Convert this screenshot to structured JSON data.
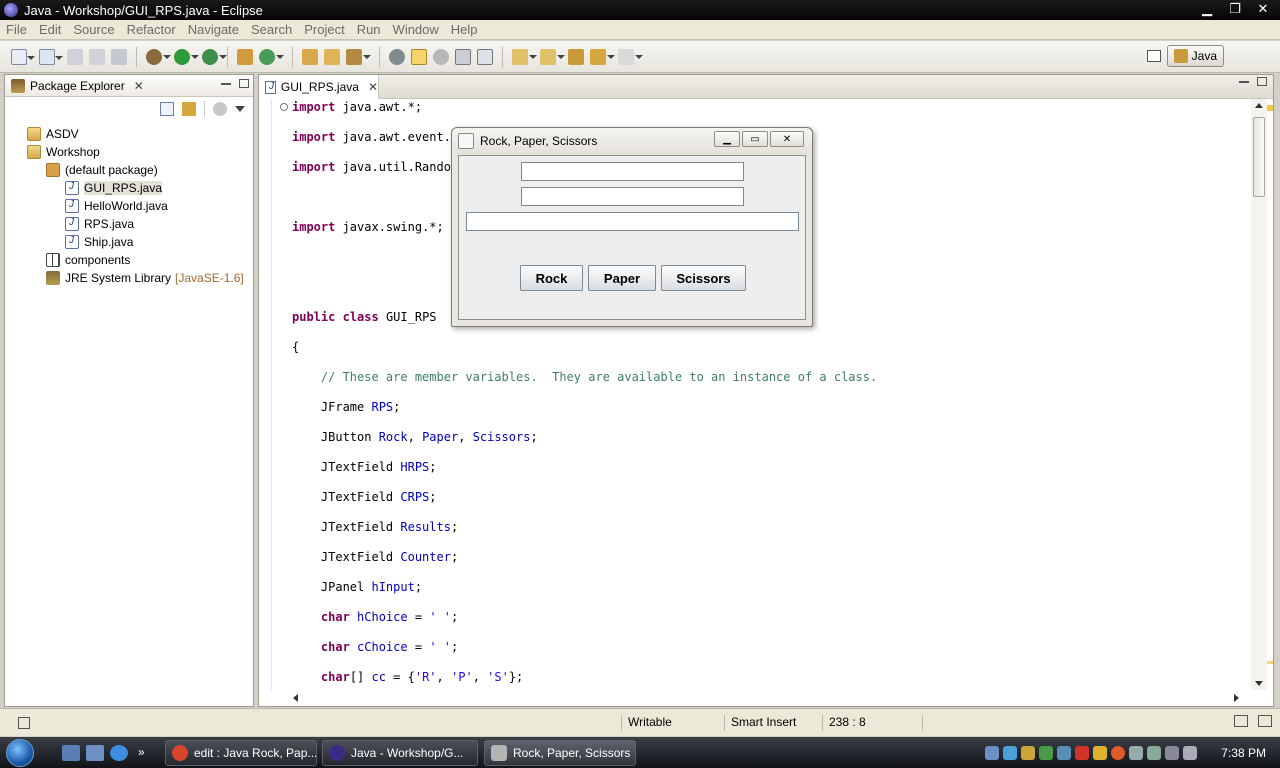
{
  "window": {
    "title": "Java - Workshop/GUI_RPS.java - Eclipse"
  },
  "menu": [
    "File",
    "Edit",
    "Source",
    "Refactor",
    "Navigate",
    "Search",
    "Project",
    "Run",
    "Window",
    "Help"
  ],
  "perspective": {
    "label": "Java"
  },
  "package_explorer": {
    "title": "Package Explorer",
    "tree": [
      {
        "label": "ASDV",
        "icon": "project-folder-icon",
        "level": 1
      },
      {
        "label": "Workshop",
        "icon": "project-folder-icon",
        "level": 1
      },
      {
        "label": "(default package)",
        "icon": "package-icon",
        "level": 2
      },
      {
        "label": "GUI_RPS.java",
        "icon": "java-file-icon",
        "level": 3,
        "selected": true
      },
      {
        "label": "HelloWorld.java",
        "icon": "java-file-icon",
        "level": 3
      },
      {
        "label": "RPS.java",
        "icon": "java-file-icon",
        "level": 3
      },
      {
        "label": "Ship.java",
        "icon": "java-file-icon",
        "level": 3
      },
      {
        "label": "components",
        "icon": "folder-grid-icon",
        "level": 2
      },
      {
        "label": "JRE System Library",
        "tag": "[JavaSE-1.6]",
        "icon": "library-icon",
        "level": 2
      }
    ]
  },
  "editor": {
    "tab": "GUI_RPS.java",
    "lines": [
      [
        [
          "kw",
          "import"
        ],
        [
          "t",
          " java.awt.*;"
        ]
      ],
      [
        [
          "kw",
          "import"
        ],
        [
          "t",
          " java.awt.event.*"
        ]
      ],
      [
        [
          "kw",
          "import"
        ],
        [
          "t",
          " java.util.Random"
        ]
      ],
      [],
      [
        [
          "kw",
          "import"
        ],
        [
          "t",
          " javax.swing.*;"
        ]
      ],
      [],
      [],
      [
        [
          "kw",
          "public"
        ],
        [
          "t",
          " "
        ],
        [
          "kw",
          "class"
        ],
        [
          "t",
          " GUI_RPS"
        ]
      ],
      [
        [
          "t",
          "{"
        ]
      ],
      [
        [
          "t",
          "    "
        ],
        [
          "cm",
          "// These are member variables.  They are available to an instance of a class."
        ]
      ],
      [
        [
          "t",
          "    JFrame "
        ],
        [
          "fd",
          "RPS"
        ],
        [
          "t",
          ";"
        ]
      ],
      [
        [
          "t",
          "    JButton "
        ],
        [
          "fd",
          "Rock"
        ],
        [
          "t",
          ", "
        ],
        [
          "fd",
          "Paper"
        ],
        [
          "t",
          ", "
        ],
        [
          "fd",
          "Scissors"
        ],
        [
          "t",
          ";"
        ]
      ],
      [
        [
          "t",
          "    JTextField "
        ],
        [
          "fd",
          "HRPS"
        ],
        [
          "t",
          ";"
        ]
      ],
      [
        [
          "t",
          "    JTextField "
        ],
        [
          "fd",
          "CRPS"
        ],
        [
          "t",
          ";"
        ]
      ],
      [
        [
          "t",
          "    JTextField "
        ],
        [
          "fd",
          "Results"
        ],
        [
          "t",
          ";"
        ]
      ],
      [
        [
          "t",
          "    JTextField "
        ],
        [
          "fd",
          "Counter"
        ],
        [
          "t",
          ";"
        ]
      ],
      [
        [
          "t",
          "    JPanel "
        ],
        [
          "fd",
          "hInput"
        ],
        [
          "t",
          ";"
        ]
      ],
      [
        [
          "t",
          "    "
        ],
        [
          "kw",
          "char"
        ],
        [
          "t",
          " "
        ],
        [
          "fd",
          "hChoice"
        ],
        [
          "t",
          " = "
        ],
        [
          "st",
          "' '"
        ],
        [
          "t",
          ";"
        ]
      ],
      [
        [
          "t",
          "    "
        ],
        [
          "kw",
          "char"
        ],
        [
          "t",
          " "
        ],
        [
          "fd",
          "cChoice"
        ],
        [
          "t",
          " = "
        ],
        [
          "st",
          "' '"
        ],
        [
          "t",
          ";"
        ]
      ],
      [
        [
          "t",
          "    "
        ],
        [
          "kw",
          "char"
        ],
        [
          "t",
          "[] "
        ],
        [
          "fd",
          "cc"
        ],
        [
          "t",
          " = {"
        ],
        [
          "st",
          "'R'"
        ],
        [
          "t",
          ", "
        ],
        [
          "st",
          "'P'"
        ],
        [
          "t",
          ", "
        ],
        [
          "st",
          "'S'"
        ],
        [
          "t",
          "};"
        ]
      ]
    ]
  },
  "app_frame": {
    "title": "Rock, Paper, Scissors",
    "buttons": {
      "rock": "Rock",
      "paper": "Paper",
      "scissors": "Scissors"
    }
  },
  "status": {
    "writable": "Writable",
    "insert_mode": "Smart Insert",
    "position": "238 : 8"
  },
  "taskbar": {
    "items": [
      {
        "label": "edit : Java Rock, Pap...",
        "color": "#d9452c"
      },
      {
        "label": "Java - Workshop/G...",
        "color": "#3b2a86"
      },
      {
        "label": "Rock, Paper, Scissors",
        "color": "#b4b4b4"
      }
    ],
    "clock": "7:38 PM",
    "more_glyph": "»"
  },
  "colors": {
    "keyword": "#7f0055",
    "comment": "#3f7f5f",
    "field": "#0000c0",
    "string": "#2a00ff"
  }
}
